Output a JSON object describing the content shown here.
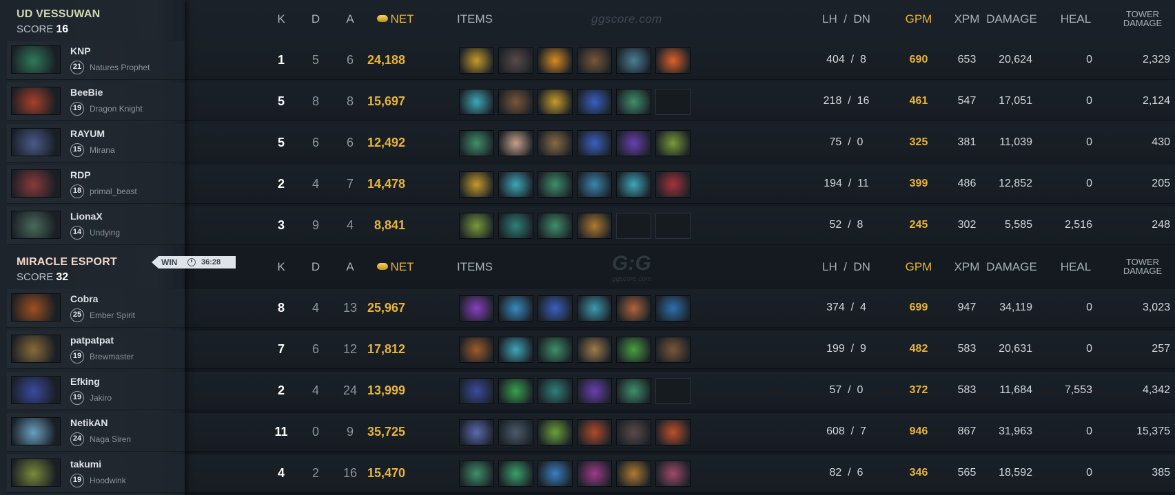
{
  "colors": {
    "gold": "#e8b43a",
    "kills": "#ffffff",
    "muted": "#8d959e",
    "bg": "#141a20"
  },
  "headers": {
    "k": "K",
    "d": "D",
    "a": "A",
    "net": "NET",
    "items": "ITEMS",
    "lhdn": "LH  /  DN",
    "gpm": "GPM",
    "xpm": "XPM",
    "damage": "DAMAGE",
    "heal": "HEAL",
    "tower_line1": "TOWER",
    "tower_line2": "DAMAGE"
  },
  "watermark": {
    "text": "ggscore.com",
    "logo": "G:G",
    "logo_sub": "ggscore.com"
  },
  "win": {
    "label": "WIN",
    "time": "36:28"
  },
  "teams": [
    {
      "name": "UD VESSUWAN",
      "score_label": "SCORE",
      "score": "16",
      "players": [
        {
          "name": "KNP",
          "level": "21",
          "hero": "Natures Prophet",
          "portrait": "natures-prophet-portrait",
          "k": "1",
          "d": "5",
          "a": "6",
          "net": "24,188",
          "lhdn": "404  /  8",
          "gpm": "690",
          "xpm": "653",
          "damage": "20,624",
          "heal": "0",
          "tower": "2,329",
          "items": [
            "#c79a2a",
            "#5a4a48",
            "#d98a20",
            "#7a5638",
            "#4a7f95",
            "#e0602a"
          ]
        },
        {
          "name": "BeeBie",
          "level": "19",
          "hero": "Dragon Knight",
          "portrait": "dragon-knight-portrait",
          "k": "5",
          "d": "8",
          "a": "8",
          "net": "15,697",
          "lhdn": "218  /  16",
          "gpm": "461",
          "xpm": "547",
          "damage": "17,051",
          "heal": "0",
          "tower": "2,124",
          "items": [
            "#3fa6b8",
            "#7a5638",
            "#c79a2a",
            "#3a5fc0",
            "#3f8f6a",
            ""
          ]
        },
        {
          "name": "RAYUM",
          "level": "15",
          "hero": "Mirana",
          "portrait": "mirana-portrait",
          "k": "5",
          "d": "6",
          "a": "6",
          "net": "12,492",
          "lhdn": "75  /  0",
          "gpm": "325",
          "xpm": "381",
          "damage": "11,039",
          "heal": "0",
          "tower": "430",
          "items": [
            "#3f8f6a",
            "#c8a08a",
            "#8a6a45",
            "#3a5fc0",
            "#6a3fb0",
            "#7a9a3a"
          ]
        },
        {
          "name": "RDP",
          "level": "18",
          "hero": "primal_beast",
          "portrait": "primal-beast-portrait",
          "k": "2",
          "d": "4",
          "a": "7",
          "net": "14,478",
          "lhdn": "194  /  11",
          "gpm": "399",
          "xpm": "486",
          "damage": "12,852",
          "heal": "0",
          "tower": "205",
          "items": [
            "#c79a2a",
            "#3fa6b8",
            "#3f8f6a",
            "#3a86b0",
            "#3fa6b8",
            "#a8323a"
          ]
        },
        {
          "name": "LionaX",
          "level": "14",
          "hero": "Undying",
          "portrait": "undying-portrait",
          "k": "3",
          "d": "9",
          "a": "4",
          "net": "8,841",
          "lhdn": "52  /  8",
          "gpm": "245",
          "xpm": "302",
          "damage": "5,585",
          "heal": "2,516",
          "tower": "248",
          "items": [
            "#7a9a3a",
            "#2f7f7a",
            "#3f8f6a",
            "#b07a30",
            "",
            ""
          ]
        }
      ]
    },
    {
      "name": "MIRACLE ESPORT",
      "score_label": "SCORE",
      "score": "32",
      "players": [
        {
          "name": "Cobra",
          "level": "25",
          "hero": "Ember Spirit",
          "portrait": "ember-spirit-portrait",
          "k": "8",
          "d": "4",
          "a": "13",
          "net": "25,967",
          "lhdn": "374  /  4",
          "gpm": "699",
          "xpm": "947",
          "damage": "34,119",
          "heal": "0",
          "tower": "3,023",
          "items": [
            "#8a3fc0",
            "#3a8ac0",
            "#3a5fc0",
            "#3f9ab0",
            "#b0643a",
            "#2f6fb0"
          ]
        },
        {
          "name": "patpatpat",
          "level": "19",
          "hero": "Brewmaster",
          "portrait": "brewmaster-portrait",
          "k": "7",
          "d": "6",
          "a": "12",
          "net": "17,812",
          "lhdn": "199  /  9",
          "gpm": "482",
          "xpm": "583",
          "damage": "20,631",
          "heal": "0",
          "tower": "257",
          "items": [
            "#a05a2a",
            "#3fa6b8",
            "#3f8f6a",
            "#a07a4a",
            "#4aa040",
            "#7a5638"
          ]
        },
        {
          "name": "Efking",
          "level": "19",
          "hero": "Jakiro",
          "portrait": "jakiro-portrait",
          "k": "2",
          "d": "4",
          "a": "24",
          "net": "13,999",
          "lhdn": "57  /  0",
          "gpm": "372",
          "xpm": "583",
          "damage": "11,684",
          "heal": "7,553",
          "tower": "4,342",
          "items": [
            "#3a4aa0",
            "#3aa050",
            "#2f7f7a",
            "#6a3fb0",
            "#3f8f6a",
            ""
          ]
        },
        {
          "name": "NetikAN",
          "level": "24",
          "hero": "Naga Siren",
          "portrait": "naga-siren-portrait",
          "k": "11",
          "d": "0",
          "a": "9",
          "net": "35,725",
          "lhdn": "608  /  7",
          "gpm": "946",
          "xpm": "867",
          "damage": "31,963",
          "heal": "0",
          "tower": "15,375",
          "items": [
            "#5a6ab0",
            "#4a5a6a",
            "#6aa03a",
            "#b04a2a",
            "#5a4a48",
            "#c0502a"
          ]
        },
        {
          "name": "takumi",
          "level": "19",
          "hero": "Hoodwink",
          "portrait": "hoodwink-portrait",
          "k": "4",
          "d": "2",
          "a": "16",
          "net": "15,470",
          "lhdn": "82  /  6",
          "gpm": "346",
          "xpm": "565",
          "damage": "18,592",
          "heal": "0",
          "tower": "385",
          "items": [
            "#3f8f6a",
            "#3aa06a",
            "#3a7fc0",
            "#a03a8a",
            "#b07a30",
            "#a04a6a"
          ]
        }
      ]
    }
  ]
}
